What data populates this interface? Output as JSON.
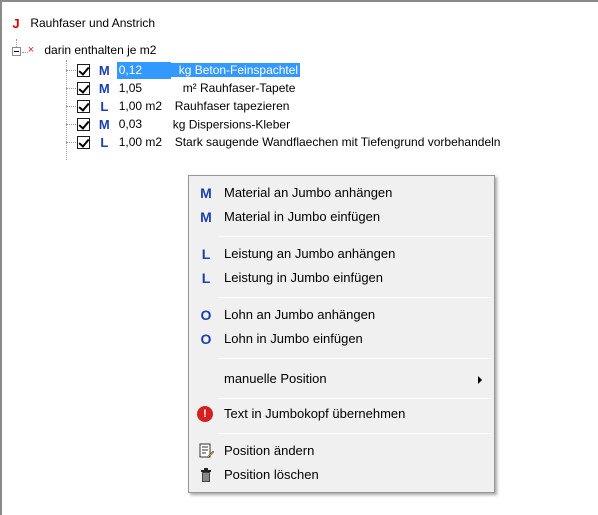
{
  "tree": {
    "root": {
      "icon_letter": "J",
      "label": "Rauhfaser und Anstrich"
    },
    "group": {
      "label": "darin enthalten je m2"
    },
    "items": [
      {
        "letter": "M",
        "qty": "0,12",
        "unit_desc": "kg Beton-Feinspachtel",
        "checked": true,
        "selected": true
      },
      {
        "letter": "M",
        "qty": "1,05",
        "unit_desc": "m² Rauhfaser-Tapete",
        "checked": true,
        "selected": false
      },
      {
        "letter": "L",
        "qty": "1,00 m2",
        "unit_desc": "Rauhfaser tapezieren",
        "checked": true,
        "selected": false
      },
      {
        "letter": "M",
        "qty": "0,03",
        "unit_desc": "kg Dispersions-Kleber",
        "checked": true,
        "selected": false
      },
      {
        "letter": "L",
        "qty": "1,00 m2",
        "unit_desc": "Stark saugende Wandflaechen mit Tiefengrund vorbehandeln",
        "checked": true,
        "selected": false
      }
    ]
  },
  "context_menu": {
    "items": [
      {
        "icon": "M",
        "label": "Material an Jumbo anhängen"
      },
      {
        "icon": "M",
        "label": "Material in Jumbo einfügen"
      },
      {
        "icon": "L",
        "label": "Leistung an Jumbo anhängen"
      },
      {
        "icon": "L",
        "label": "Leistung in Jumbo einfügen"
      },
      {
        "icon": "O",
        "label": "Lohn an Jumbo anhängen"
      },
      {
        "icon": "O",
        "label": "Lohn in Jumbo einfügen"
      },
      {
        "icon": "",
        "label": "manuelle Position"
      },
      {
        "icon": "warning-icon",
        "label": "Text in Jumbokopf übernehmen"
      },
      {
        "icon": "edit-document-icon",
        "label": "Position ändern"
      },
      {
        "icon": "trash-icon",
        "label": "Position löschen"
      }
    ]
  },
  "colors": {
    "selection": "#3399ff",
    "letter_blue": "#1a3fb0",
    "letter_red": "#e00000"
  }
}
